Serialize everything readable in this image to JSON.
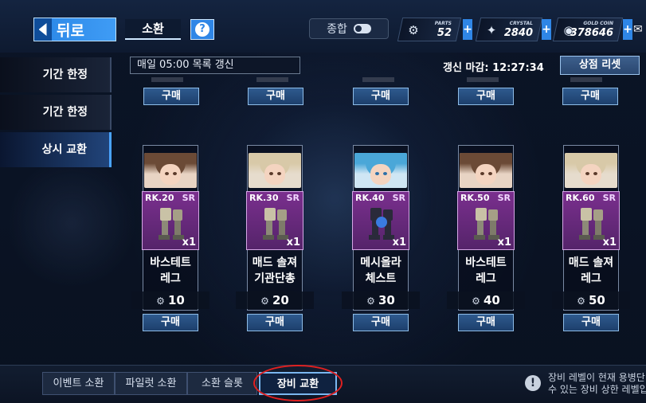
{
  "topbar": {
    "back_label": "뒤로",
    "summon_label": "소환",
    "help_icon": "?",
    "overall_label": "종합"
  },
  "resources": {
    "parts": {
      "name": "PARTS",
      "value": "52"
    },
    "crystal": {
      "name": "CRYSTAL",
      "value": "2840"
    },
    "gold": {
      "name": "GOLD COIN",
      "value": "378646"
    }
  },
  "leftmenu": [
    {
      "label": "기간 한정"
    },
    {
      "label": "기간 한정"
    },
    {
      "label": "상시 교환"
    }
  ],
  "shop": {
    "refresh_info": "매일 05:00 목록 갱신",
    "deadline": "갱신 마감: 12:27:34",
    "reset_label": "상점 리셋",
    "buy_label": "구매"
  },
  "items": [
    {
      "rank": "RK.20",
      "rarity": "SR",
      "qty": "x1",
      "name": "바스테트\n레그",
      "price": "10",
      "hair": "#6b4a36",
      "bg": "#e8d4c4"
    },
    {
      "rank": "RK.30",
      "rarity": "SR",
      "qty": "x1",
      "name": "매드 솔져\n기관단총",
      "price": "20",
      "hair": "#d8c9a8",
      "bg": "#e6dccd"
    },
    {
      "rank": "RK.40",
      "rarity": "SR",
      "qty": "x1",
      "name": "메시올라\n체스트",
      "price": "30",
      "hair": "#4aa7d8",
      "bg": "#cfe6f4"
    },
    {
      "rank": "RK.50",
      "rarity": "SR",
      "qty": "x1",
      "name": "바스테트\n레그",
      "price": "40",
      "hair": "#6b4a36",
      "bg": "#e8d4c4"
    },
    {
      "rank": "RK.60",
      "rarity": "SR",
      "qty": "x1",
      "name": "매드 솔져\n레그",
      "price": "50",
      "hair": "#d8c9a8",
      "bg": "#e6dccd"
    }
  ],
  "bottom_tabs": [
    {
      "label": "이벤트 소환"
    },
    {
      "label": "파일럿 소환"
    },
    {
      "label": "소환 슬롯"
    },
    {
      "label": "장비 교환"
    }
  ],
  "notice": {
    "line1": "장비 레벨이 현재 용병단",
    "line2": "수 있는 장비 상한 레벨입"
  },
  "colors": {
    "accent": "#2f86e6",
    "item_purple": "#7a2f8e",
    "highlight_ring": "#e02020"
  }
}
